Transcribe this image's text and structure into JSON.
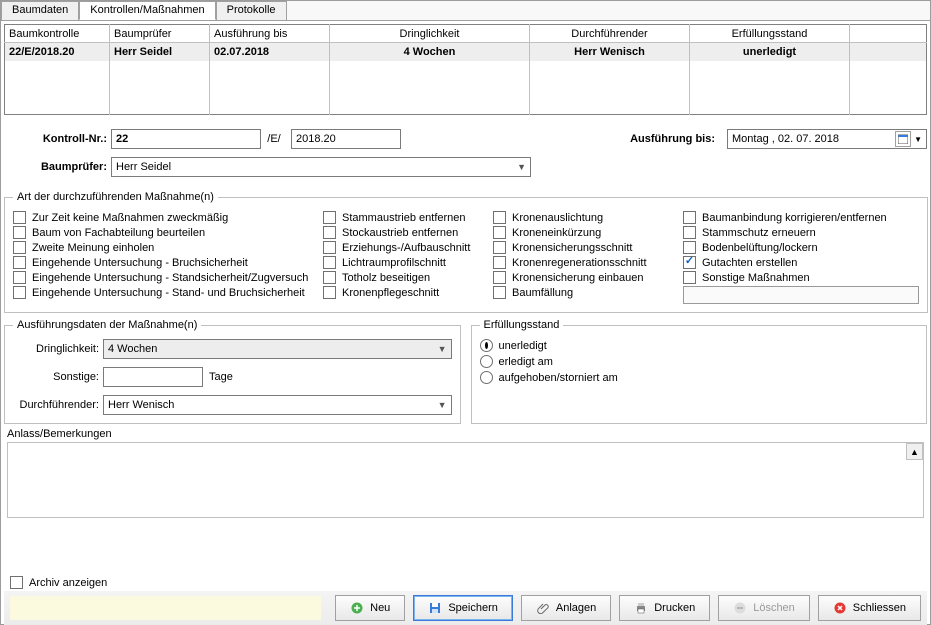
{
  "tabs": {
    "baumdaten": "Baumdaten",
    "kontrollen": "Kontrollen/Maßnahmen",
    "protokolle": "Protokolle"
  },
  "grid": {
    "headers": {
      "h0": "Baumkontrolle",
      "h1": "Baumprüfer",
      "h2": "Ausführung bis",
      "h3": "Dringlichkeit",
      "h4": "Durchführender",
      "h5": "Erfüllungsstand"
    },
    "row": {
      "c0": "22/E/2018.20",
      "c1": "Herr Seidel",
      "c2": "02.07.2018",
      "c3": "4 Wochen",
      "c4": "Herr Wenisch",
      "c5": "unerledigt"
    }
  },
  "form": {
    "kontroll_label": "Kontroll-Nr.:",
    "kontroll_num": "22",
    "kontroll_mid": "/E/",
    "kontroll_year": "2018.20",
    "ausfuehrung_label": "Ausführung bis:",
    "date_value": "Montag  , 02. 07. 2018",
    "baumpruefer_label": "Baumprüfer:",
    "baumpruefer_val": "Herr Seidel"
  },
  "massnahmen": {
    "legend": "Art der durchzuführenden Maßnahme(n)",
    "col1": [
      "Zur Zeit keine Maßnahmen zweckmäßig",
      "Baum von Fachabteilung beurteilen",
      "Zweite Meinung einholen",
      "Eingehende Untersuchung - Bruchsicherheit",
      "Eingehende Untersuchung - Standsicherheit/Zugversuch",
      "Eingehende Untersuchung - Stand- und Bruchsicherheit"
    ],
    "col2": [
      "Stammaustrieb entfernen",
      "Stockaustrieb entfernen",
      "Erziehungs-/Aufbauschnitt",
      "Lichtraumprofilschnitt",
      "Totholz beseitigen",
      "Kronenpflegeschnitt"
    ],
    "col3": [
      "Kronenauslichtung",
      "Kroneneinkürzung",
      "Kronensicherungsschnitt",
      "Kronenregenerationsschnitt",
      "Kronensicherung einbauen",
      "Baumfällung"
    ],
    "col4": [
      "Baumanbindung korrigieren/entfernen",
      "Stammschutz erneuern",
      "Bodenbelüftung/lockern",
      "Gutachten erstellen",
      "Sonstige Maßnahmen"
    ],
    "checked_item": "Gutachten erstellen"
  },
  "ausfuehrung": {
    "legend": "Ausführungsdaten der Maßnahme(n)",
    "dringlichkeit_lbl": "Dringlichkeit:",
    "dringlichkeit_val": "4 Wochen",
    "sonstige_lbl": "Sonstige:",
    "sonstige_val": "",
    "tage_lbl": "Tage",
    "durchf_lbl": "Durchführender:",
    "durchf_val": "Herr Wenisch"
  },
  "erfuell": {
    "legend": "Erfüllungsstand",
    "r1": "unerledigt",
    "r2": "erledigt am",
    "r3": "aufgehoben/storniert am",
    "selected": "unerledigt"
  },
  "remarks_lbl": "Anlass/Bemerkungen",
  "archive_lbl": "Archiv anzeigen",
  "buttons": {
    "neu": "Neu",
    "speichern": "Speichern",
    "anlagen": "Anlagen",
    "drucken": "Drucken",
    "loeschen": "Löschen",
    "schliessen": "Schliessen"
  }
}
